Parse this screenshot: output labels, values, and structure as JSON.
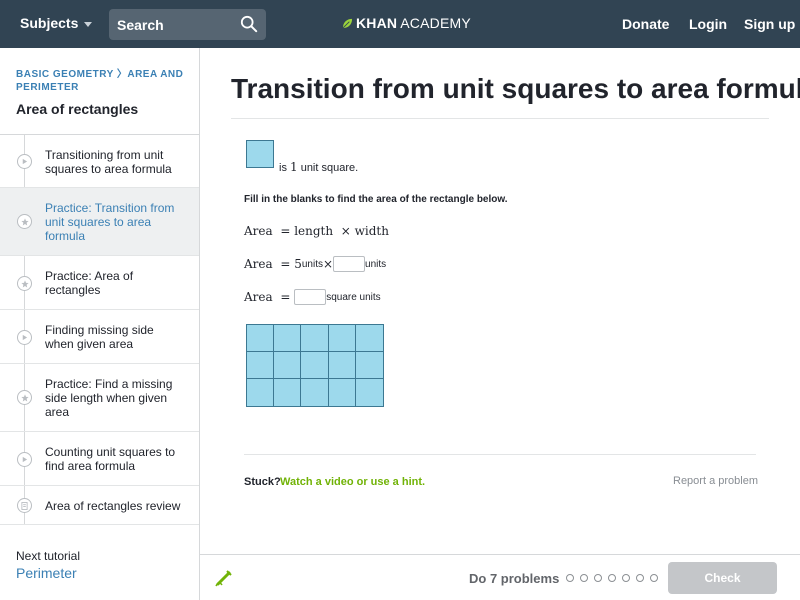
{
  "nav": {
    "subjects_label": "Subjects",
    "search_placeholder": "Search",
    "logo_kh": "KHAN",
    "logo_rest": "ACADEMY",
    "donate": "Donate",
    "login": "Login",
    "signup": "Sign up"
  },
  "sidebar": {
    "breadcrumb": "BASIC GEOMETRY 〉AREA AND PERIMETER",
    "title": "Area of rectangles",
    "items": [
      {
        "label": "Transitioning from unit squares to area formula",
        "icon": "play-icon",
        "active": false
      },
      {
        "label": "Practice: Transition from unit squares to area formula",
        "icon": "star-icon",
        "active": true
      },
      {
        "label": "Practice: Area of rectangles",
        "icon": "star-icon",
        "active": false
      },
      {
        "label": "Finding missing side when given area",
        "icon": "play-icon",
        "active": false
      },
      {
        "label": "Practice: Find a missing side length when given area",
        "icon": "star-icon",
        "active": false
      },
      {
        "label": "Counting unit squares to find area formula",
        "icon": "play-icon",
        "active": false
      },
      {
        "label": "Area of rectangles review",
        "icon": "article-icon",
        "active": false
      }
    ],
    "next_label": "Next tutorial",
    "next_link": "Perimeter"
  },
  "main": {
    "title": "Transition from unit squares to area formula",
    "unit_text_is": "is ",
    "unit_text_num": "1",
    "unit_text_rest": " unit square.",
    "instruction": "Fill in the blanks to find the area of the rectangle below.",
    "eq1": {
      "lhs": "Area",
      "eq": "=",
      "a": "length",
      "times": "×",
      "b": "width"
    },
    "eq2": {
      "lhs": "Area",
      "eq": "=",
      "num": "5",
      "unit1": " units ",
      "times": "×",
      "unit2": " units"
    },
    "eq3": {
      "lhs": "Area",
      "eq": "=",
      "unit": " square units"
    },
    "grid": {
      "rows": 3,
      "cols": 5
    },
    "stuck": "Stuck?",
    "hint_link": "Watch a video or use a hint.",
    "report": "Report a problem"
  },
  "footer": {
    "do_problems": "Do 7 problems",
    "dots": 7,
    "check": "Check"
  },
  "colors": {
    "topbar": "#314453",
    "square_fill": "#9dd9ec",
    "square_border": "#3c7892",
    "link": "#3b80b4",
    "hint": "#71b307"
  }
}
